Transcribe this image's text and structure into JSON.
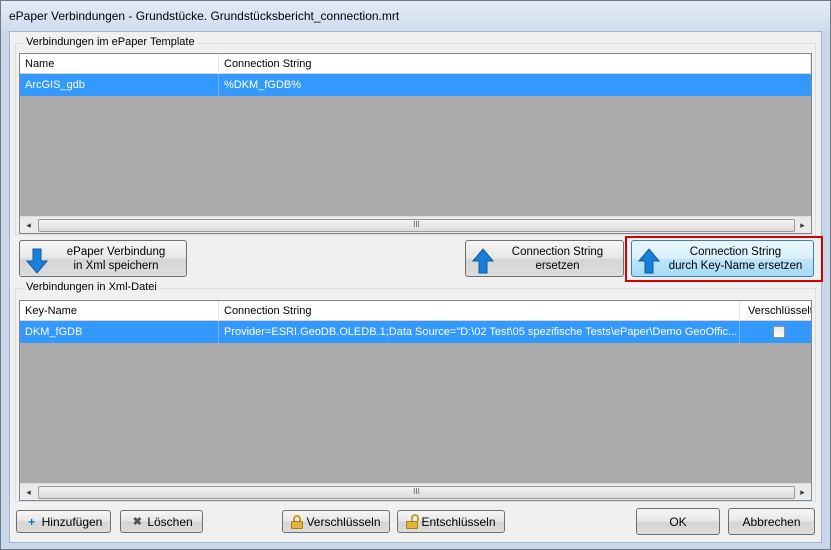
{
  "window": {
    "title": "ePaper Verbindungen - Grundstücke. Grundstücksbericht_connection.mrt"
  },
  "template_group": {
    "label": "Verbindungen im ePaper Template",
    "columns": [
      "Name",
      "Connection String"
    ],
    "rows": [
      {
        "name": "ArcGIS_gdb",
        "connection": "%DKM_fGDB%",
        "selected": true
      }
    ]
  },
  "middle_buttons": {
    "save_xml": [
      "ePaper Verbindung",
      "in Xml speichern"
    ],
    "replace": [
      "Connection String",
      "ersetzen"
    ],
    "replace_key": [
      "Connection String",
      "durch Key-Name ersetzen"
    ]
  },
  "xml_group": {
    "label": "Verbindungen in Xml-Datei",
    "columns": [
      "Key-Name",
      "Connection String",
      "Verschlüsselt"
    ],
    "rows": [
      {
        "key": "DKM_fGDB",
        "connection": "Provider=ESRI.GeoDB.OLEDB.1;Data Source=\"D:\\02 Test\\05 spezifische Tests\\ePaper\\Demo GeoOffic...",
        "encrypted": false,
        "selected": true
      }
    ]
  },
  "scrollbar": {
    "thumb_glyph": "III",
    "left_arrow": "◂",
    "right_arrow": "▸"
  },
  "bottom_buttons": {
    "add": "Hinzufügen",
    "delete": "Löschen",
    "encrypt": "Verschlüsseln",
    "decrypt": "Entschlüsseln",
    "ok": "OK",
    "cancel": "Abbrechen"
  },
  "icons": {
    "add": "+",
    "delete": "✖"
  },
  "colors": {
    "selection": "#3399ff",
    "highlight": "#d60000",
    "arrow": "#1a7fd8"
  }
}
